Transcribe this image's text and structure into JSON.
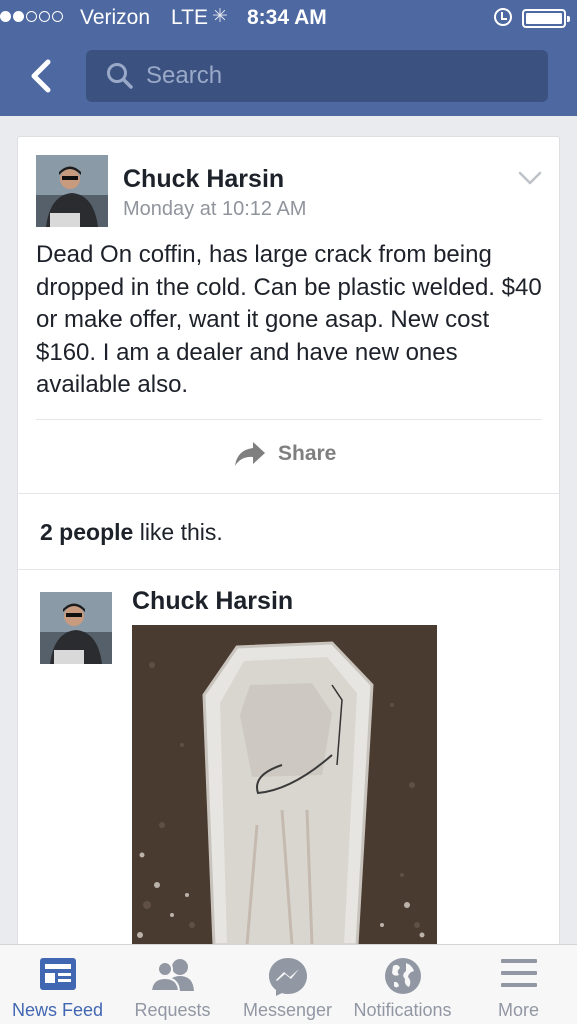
{
  "status_bar": {
    "carrier": "Verizon",
    "network": "LTE",
    "time": "8:34 AM",
    "signal_bars_filled": 2,
    "signal_bars_total": 5
  },
  "nav": {
    "search_placeholder": "Search"
  },
  "post": {
    "author": "Chuck Harsin",
    "timestamp": "Monday at 10:12 AM",
    "text": "Dead On coffin, has large crack from being dropped in the cold.  Can be plastic welded. $40 or make offer, want it gone asap. New cost $160.  I am a dealer and have new ones available also.",
    "share_label": "Share",
    "likes_count": "2 people",
    "likes_suffix": " like this."
  },
  "comment": {
    "author": "Chuck Harsin"
  },
  "tabs": [
    {
      "label": "News Feed",
      "icon": "news-feed-icon",
      "active": true
    },
    {
      "label": "Requests",
      "icon": "friend-requests-icon",
      "active": false
    },
    {
      "label": "Messenger",
      "icon": "messenger-icon",
      "active": false
    },
    {
      "label": "Notifications",
      "icon": "globe-icon",
      "active": false
    },
    {
      "label": "More",
      "icon": "menu-icon",
      "active": false
    }
  ],
  "colors": {
    "header_bg": "#4e69a2",
    "search_bg": "#3b5281",
    "active_tab": "#4267b2",
    "inactive_tab": "#9197a3"
  }
}
